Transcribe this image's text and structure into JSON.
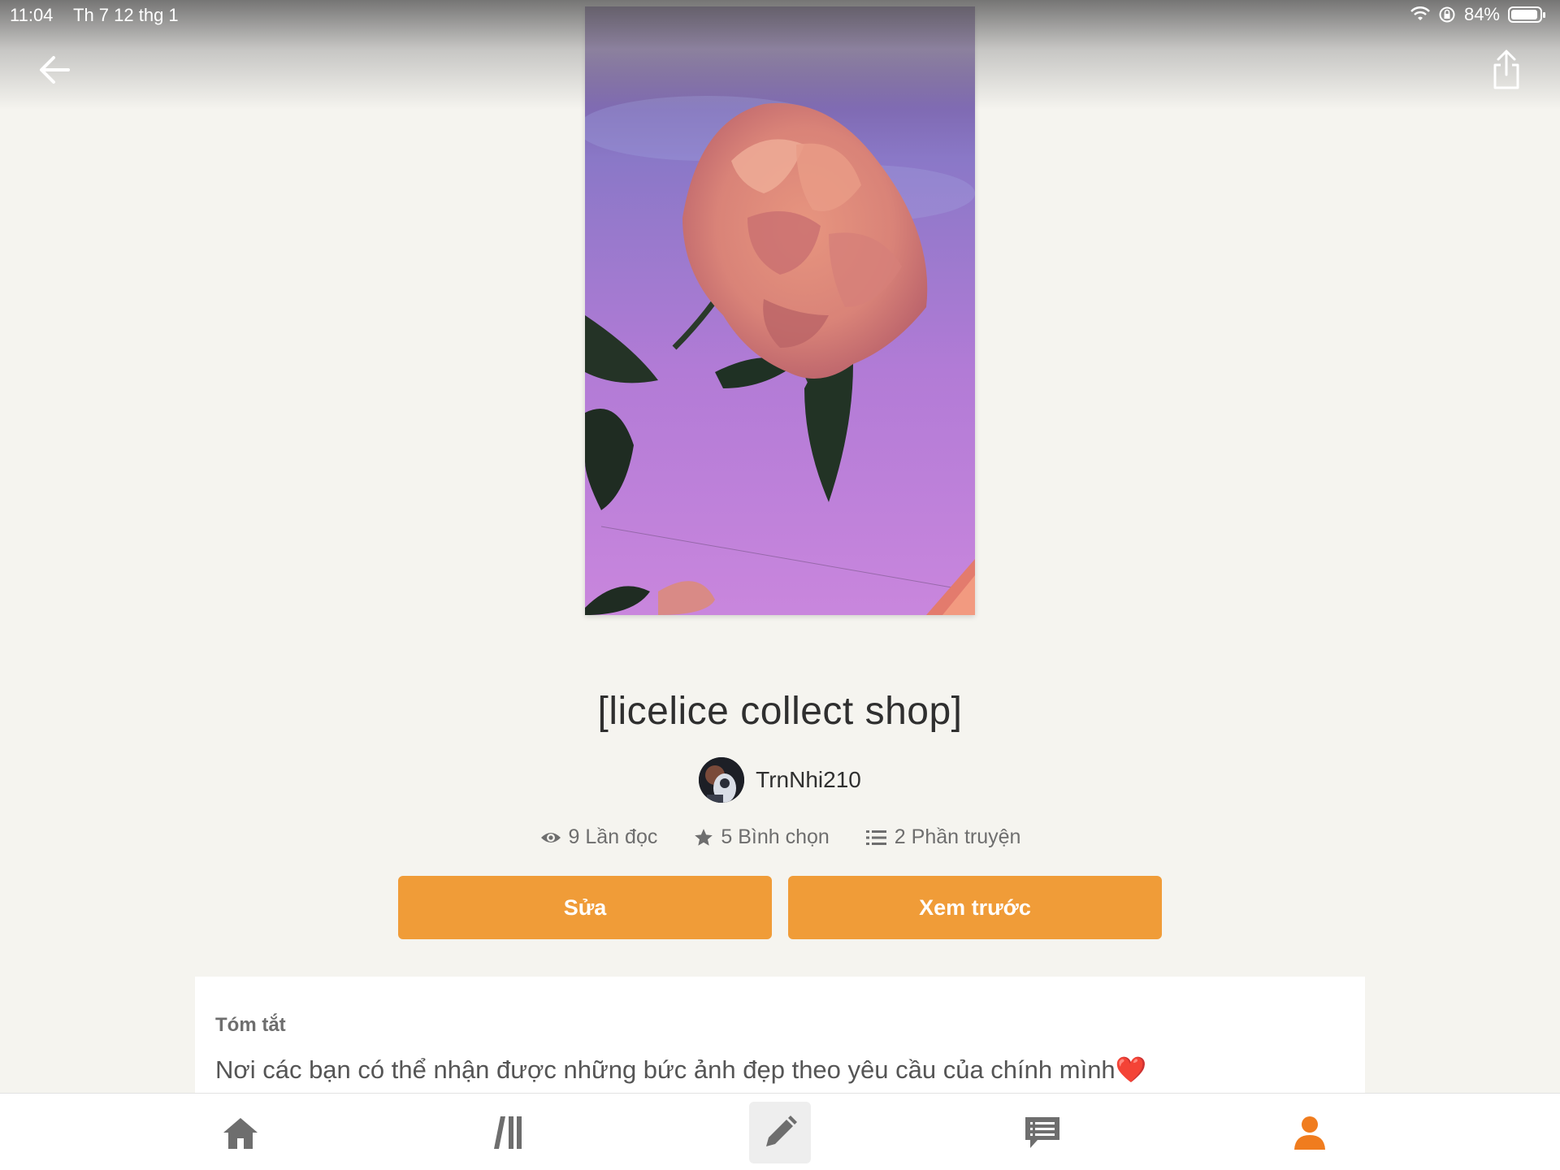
{
  "status_bar": {
    "time": "11:04",
    "date": "Th 7 12 thg 1",
    "battery": "84%",
    "battery_level": 0.84
  },
  "story": {
    "title": "[licelice collect shop]",
    "author": "TrnNhi210",
    "stats": {
      "reads": "9 Lần đọc",
      "votes": "5 Bình chọn",
      "parts": "2 Phần truyện"
    }
  },
  "actions": {
    "edit_label": "Sửa",
    "preview_label": "Xem trước"
  },
  "summary": {
    "label": "Tóm tắt",
    "text": "Nơi các bạn có thể nhận được những bức ảnh đẹp theo yêu cầu của chính mình",
    "emoji": "❤️"
  },
  "tabs": [
    "home-icon",
    "library-icon",
    "write-icon",
    "messages-icon",
    "profile-icon"
  ],
  "colors": {
    "accent": "#f09c38",
    "background": "#f5f4ef",
    "active_tab": "#f07c1e"
  }
}
